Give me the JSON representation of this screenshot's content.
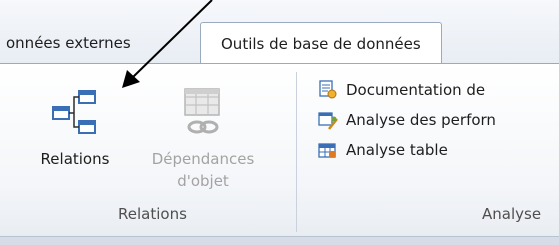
{
  "tabs": {
    "inactive_label": "onnées externes",
    "active_label": "Outils de base de données"
  },
  "ribbon": {
    "relations_button_label": "Relations",
    "dependencies_button_line1": "Dépendances",
    "dependencies_button_line2": "d'objet",
    "relations_group_label": "Relations",
    "analyse_items": [
      {
        "label": "Documentation de",
        "icon": "documenter-icon"
      },
      {
        "label": "Analyse des perforn",
        "icon": "performance-analyzer-icon"
      },
      {
        "label": "Analyse table",
        "icon": "table-analyzer-icon"
      }
    ],
    "analyse_group_label": "Analyse"
  },
  "colors": {
    "accent_border": "#9aaabf",
    "disabled_text": "#a3a3a3",
    "icon_blue": "#3a6fb5"
  }
}
